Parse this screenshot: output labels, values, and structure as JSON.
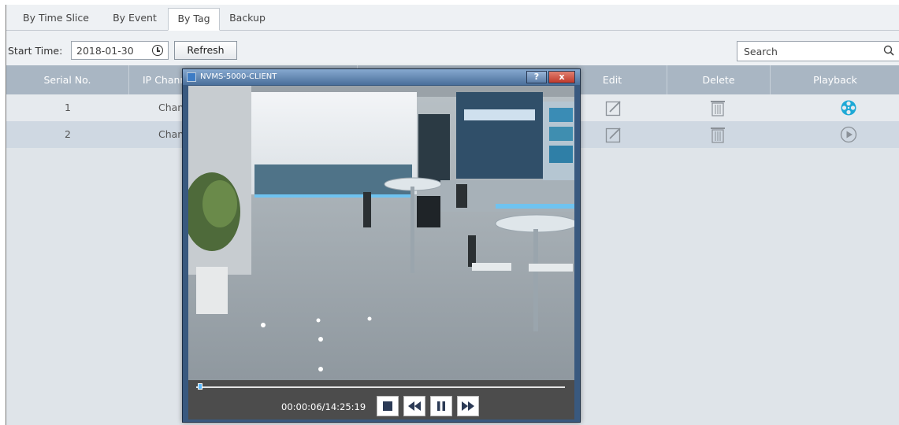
{
  "tabs": [
    {
      "label": "By Time Slice"
    },
    {
      "label": "By Event"
    },
    {
      "label": "By Tag"
    },
    {
      "label": "Backup"
    }
  ],
  "active_tab": "By Tag",
  "toolbar": {
    "start_label": "Start Time:",
    "start_value": "2018-01-30",
    "refresh_label": "Refresh",
    "search_value": "Search"
  },
  "table": {
    "columns": [
      "Serial No.",
      "IP Chann",
      "Edit",
      "Delete",
      "Playback"
    ],
    "rows": [
      {
        "serial": "1",
        "channel": "Chann"
      },
      {
        "serial": "2",
        "channel": "Chann"
      }
    ]
  },
  "popup": {
    "title": "NVMS-5000-CLIENT",
    "help_label": "?",
    "close_label": "x",
    "time": "00:00:06/14:25:19",
    "progress": 0.01
  },
  "colors": {
    "header_bg": "#a9b6c3",
    "row_alt": "#cfd8e2",
    "playback_active": "#1ea9d6",
    "popup_frame": "#39597f"
  }
}
